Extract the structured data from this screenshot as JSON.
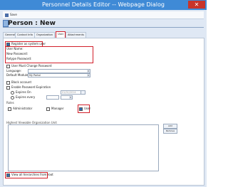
{
  "window": {
    "title": "Personnel Details Editor -- Webpage Dialog",
    "close_glyph": "✕"
  },
  "toolbar": {
    "save_label": "Save"
  },
  "tabs": [
    {
      "label": "General"
    },
    {
      "label": "Contact Info"
    },
    {
      "label": "Organization"
    },
    {
      "label": "User"
    },
    {
      "label": "Attachments"
    }
  ],
  "page_title": "Person : New",
  "form": {
    "register_label": "Register as system user",
    "user_name_label": "User Name:",
    "new_password_label": "New Password:",
    "retype_password_label": "Retype Password:",
    "must_change_label": "User Must Change Password",
    "language_label": "Language:",
    "default_module_label": "Default Module:",
    "default_module_value": "My Portal",
    "lock_account_label": "Block account",
    "enable_expiration_label": "Enable Password Expiration",
    "expires_on_label": "Expires On",
    "expires_on_value": "01/01/2014",
    "expires_every_label": "Expires every"
  },
  "roles": {
    "header": "Roles",
    "administrator_label": "Administrator",
    "manager_label": "Manager",
    "user_label": "User"
  },
  "org_unit": {
    "header": "Highest Viewable Organization Unit",
    "add_label": "Add",
    "remove_label": "Remove"
  },
  "footer": {
    "view_all_label": "View all hierarchies from root"
  },
  "colors": {
    "accent_red": "#d21f2a",
    "titlebar": "#3f8ad6"
  }
}
